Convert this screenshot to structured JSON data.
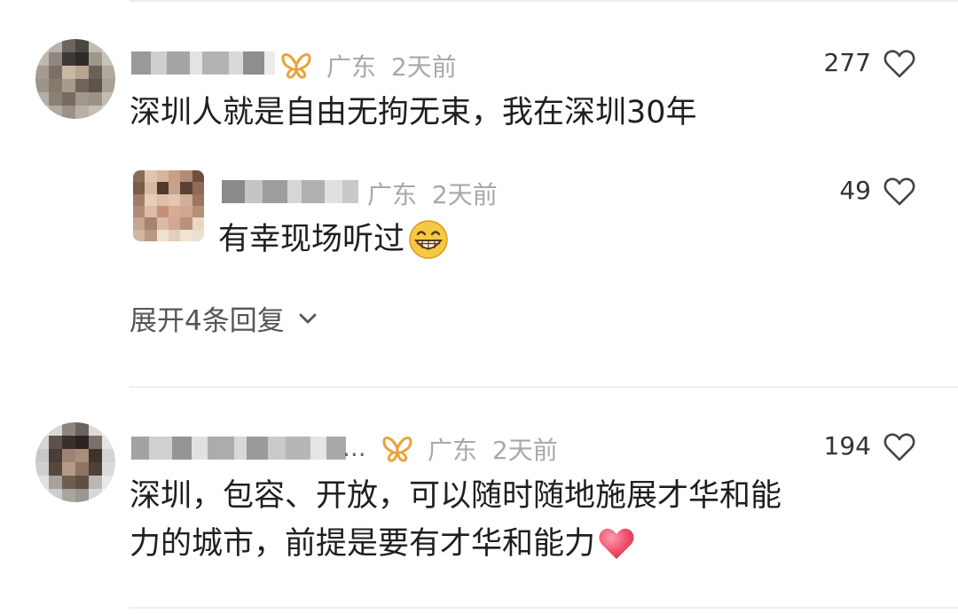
{
  "comments": [
    {
      "region": "广东",
      "time": "2天前",
      "likes": "277",
      "text": "深圳人就是自由无拘无束，我在深圳30年",
      "replies": [
        {
          "region": "广东",
          "time": "2天前",
          "likes": "49",
          "text": "有幸现场听过",
          "emoji": "grinning-face-emoji"
        }
      ],
      "expand_label": "展开4条回复"
    },
    {
      "region": "广东",
      "time": "2天前",
      "likes": "194",
      "name_ellipsis": "...",
      "text_line1": "深圳，包容、开放，可以随时随地施展才华和能",
      "text_line2": "力的城市，前提是要有才华和能力",
      "emoji": "heart-emoji"
    }
  ],
  "icons": {
    "badge": "butterfly-badge-icon",
    "like": "heart-outline-icon",
    "expand": "chevron-down-icon"
  },
  "colors": {
    "badge": "#e8a43a",
    "meta_text": "#a8a8a8",
    "heart_emoji": "#f0506e"
  }
}
